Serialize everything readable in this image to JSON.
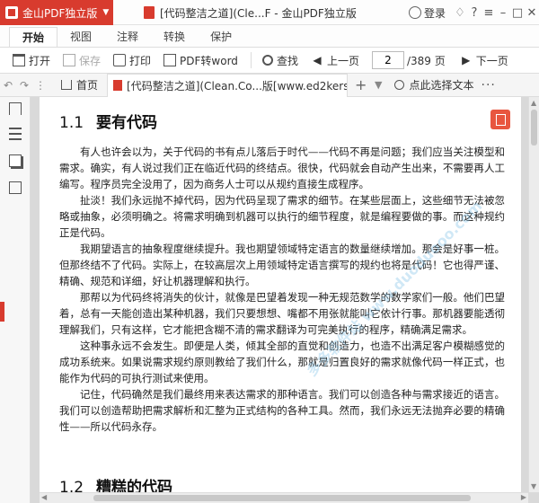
{
  "app": {
    "brand": "金山PDF独立版",
    "window_title": "[代码整洁之道](Cle...F - 金山PDF独立版",
    "login": "登录"
  },
  "ribbon_tabs": [
    "开始",
    "视图",
    "注释",
    "转换",
    "保护"
  ],
  "toolbar": {
    "open": "打开",
    "save": "保存",
    "print": "打印",
    "convert": "PDF转word",
    "find": "查找",
    "prev_page": "上一页",
    "current_page": "2",
    "total_pages": "/389 页",
    "next_page": "下一页"
  },
  "doc_tabs": {
    "home": "首页",
    "active_doc": "[代码整洁之道](Clean.Co...版[www.ed2kers.com]",
    "select_text": "点此选择文本"
  },
  "document": {
    "heading1_num": "1.1",
    "heading1": "要有代码",
    "paragraphs": [
      "有人也许会以为，关于代码的书有点儿落后于时代——代码不再是问题；我们应当关注模型和需求。确实，有人说过我们正在临近代码的终结点。很快，代码就会自动产生出来，不需要再人工编写。程序员完全没用了，因为商务人士可以从规约直接生成程序。",
      "扯淡！我们永远抛不掉代码，因为代码呈现了需求的细节。在某些层面上，这些细节无法被忽略或抽象，必须明确之。将需求明确到机器可以执行的细节程度，就是编程要做的事。而这种规约正是代码。",
      "我期望语言的抽象程度继续提升。我也期望领域特定语言的数量继续增加。那会是好事一桩。但那终结不了代码。实际上，在较高层次上用领域特定语言撰写的规约也将是代码！它也得严谨、精确、规范和详细，好让机器理解和执行。",
      "那帮以为代码终将消失的伙计，就像是巴望着发现一种无规范数学的数学家们一般。他们巴望着，总有一天能创造出某种机器，我们只要想想、嘴都不用张就能叫它依计行事。那机器要能透彻理解我们，只有这样，它才能把含糊不清的需求翻译为可完美执行的程序，精确满足需求。",
      "这种事永远不会发生。即便是人类，倾其全部的直觉和创造力，也造不出满足客户模糊感觉的成功系统来。如果说需求规约原则教给了我们什么，那就是归置良好的需求就像代码一样正式，也能作为代码的可执行测试来使用。",
      "记住，代码确然是我们最终用来表达需求的那种语言。我们可以创造各种与需求接近的语言。我们可以创造帮助把需求解析和汇整为正式结构的各种工具。然而，我们永远无法抛弃必要的精确性——所以代码永存。"
    ],
    "heading2_num": "1.2",
    "heading2": "糟糕的代码"
  },
  "watermark_text": "多多软件站 www.duoduooo.com",
  "colors": {
    "brand_red": "#d83b2e",
    "accent_orange": "#e8563f"
  },
  "icons": [
    "pdf-icon",
    "user-icon",
    "open-icon",
    "save-icon",
    "print-icon",
    "convert-icon",
    "search-icon",
    "prev-icon",
    "next-icon",
    "home-icon",
    "bookmark-icon",
    "list-icon",
    "layers-icon",
    "extract-icon"
  ]
}
